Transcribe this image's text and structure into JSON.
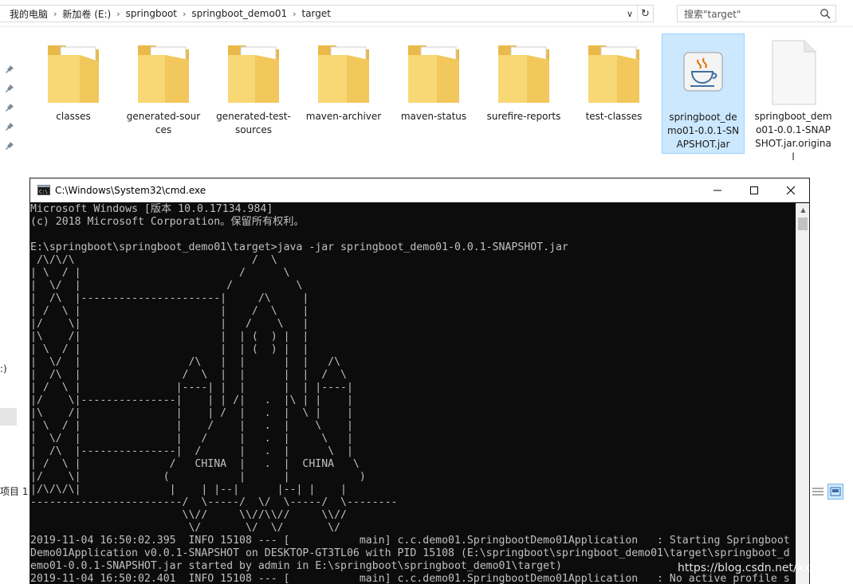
{
  "address_bar": {
    "crumbs": [
      "我的电脑",
      "新加卷 (E:)",
      "springboot",
      "springboot_demo01",
      "target"
    ],
    "dropdown_glyph": "∨",
    "refresh_glyph": "↻"
  },
  "search": {
    "text": "搜索\"target\""
  },
  "nav_pane": {
    "fragment": ":)"
  },
  "status_bar": {
    "fragment": "项目 1"
  },
  "files": [
    {
      "name": "classes",
      "icon": "folder-with-docs"
    },
    {
      "name": "generated-sources",
      "icon": "folder-with-blue-docs"
    },
    {
      "name": "generated-test-sources",
      "icon": "folder-with-docs"
    },
    {
      "name": "maven-archiver",
      "icon": "folder-with-white-docs"
    },
    {
      "name": "maven-status",
      "icon": "folder-with-docs"
    },
    {
      "name": "surefire-reports",
      "icon": "folder-with-docs"
    },
    {
      "name": "test-classes",
      "icon": "folder-with-docs"
    },
    {
      "name": "springboot_demo01-0.0.1-SNAPSHOT.jar",
      "icon": "java-jar-icon",
      "selected": true
    },
    {
      "name": "springboot_demo01-0.0.1-SNAPSHOT.jar.original",
      "icon": "blank-file-icon"
    }
  ],
  "cmd": {
    "title": "C:\\Windows\\System32\\cmd.exe",
    "output": "Microsoft Windows [版本 10.0.17134.984]\n(c) 2018 Microsoft Corporation。保留所有权利。\n\nE:\\springboot\\springboot_demo01\\target>java -jar springboot_demo01-0.0.1-SNAPSHOT.jar\n /\\/\\/\\                            /  \\\n| \\  / |                         /      \\\n|  \\/  |                       /          \\\n|  /\\  |----------------------|     /\\     |\n| /  \\ |                      |    /  \\    |\n|/    \\|                      |   /    \\   |\n|\\    /|                      |  | (  ) |  |\n| \\  / |                      |  | (  ) |  |\n|  \\/  |                 /\\   |  |      |  |   /\\\n|  /\\  |                /  \\  |  |      |  |  /  \\\n| /  \\ |               |----| |  |      |  | |----|\n|/    \\|---------------|    | | /|   .  |\\ | |    |\n|\\    /|               |    | /  |   .  |  \\ |    |\n| \\  / |               |    /    |   .  |    \\    |\n|  \\/  |               |   /     |   .  |     \\   |\n|  /\\  |---------------|  /      |   .  |      \\  |\n| /  \\ |              /   CHINA  |   .  |  CHINA   \\\n|/    \\|             (           |      |           )\n|/\\/\\/\\|              |    | |--|      |--| |    |\n------------------------/  \\-----/  \\/  \\-----/  \\--------\n                        \\\\//     \\\\//\\\\//     \\\\//\n                         \\/       \\/  \\/       \\/\n2019-11-04 16:50:02.395  INFO 15108 --- [           main] c.c.demo01.SpringbootDemo01Application   : Starting Springboot\nDemo01Application v0.0.1-SNAPSHOT on DESKTOP-GT3TL06 with PID 15108 (E:\\springboot\\springboot_demo01\\target\\springboot_d\nemo01-0.0.1-SNAPSHOT.jar started by admin in E:\\springboot\\springboot_demo01\\target)\n2019-11-04 16:50:02.401  INFO 15108 --- [           main] c.c.demo01.SpringbootDemo01Application   : No active profile s"
  },
  "watermark": "https://blog.csdn.net/xxyuanyo",
  "colors": {
    "selection": "#cce8ff",
    "folder": "#f8d775",
    "console_bg": "#0c0c0c",
    "console_fg": "#c0c0c0"
  }
}
